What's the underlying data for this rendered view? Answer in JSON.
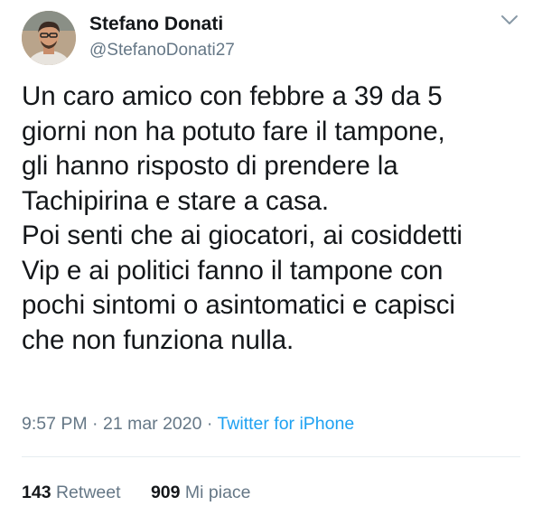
{
  "author": {
    "display_name": "Stefano Donati",
    "handle": "@StefanoDonati27",
    "avatar_icon": "user-photo-avatar"
  },
  "menu": {
    "icon": "chevron-down-icon"
  },
  "tweet": {
    "text": "Un caro amico con febbre a 39 da 5\ngiorni non ha potuto fare il tampone,\ngli hanno risposto di prendere la\nTachipirina e stare a casa.\nPoi senti che ai giocatori, ai cosiddetti\nVip e ai politici fanno il tampone con\npochi sintomi o asintomatici e capisci\nche non funziona nulla."
  },
  "meta": {
    "time": "9:57 PM",
    "separator1": " · ",
    "date": "21 mar 2020",
    "separator2": " · ",
    "source": "Twitter for iPhone"
  },
  "stats": {
    "retweets_count": "143",
    "retweets_label": "Retweet",
    "likes_count": "909",
    "likes_label": "Mi piace"
  },
  "colors": {
    "text": "#14171a",
    "secondary": "#657786",
    "link": "#1da1f2",
    "divider": "#e6ecf0"
  }
}
